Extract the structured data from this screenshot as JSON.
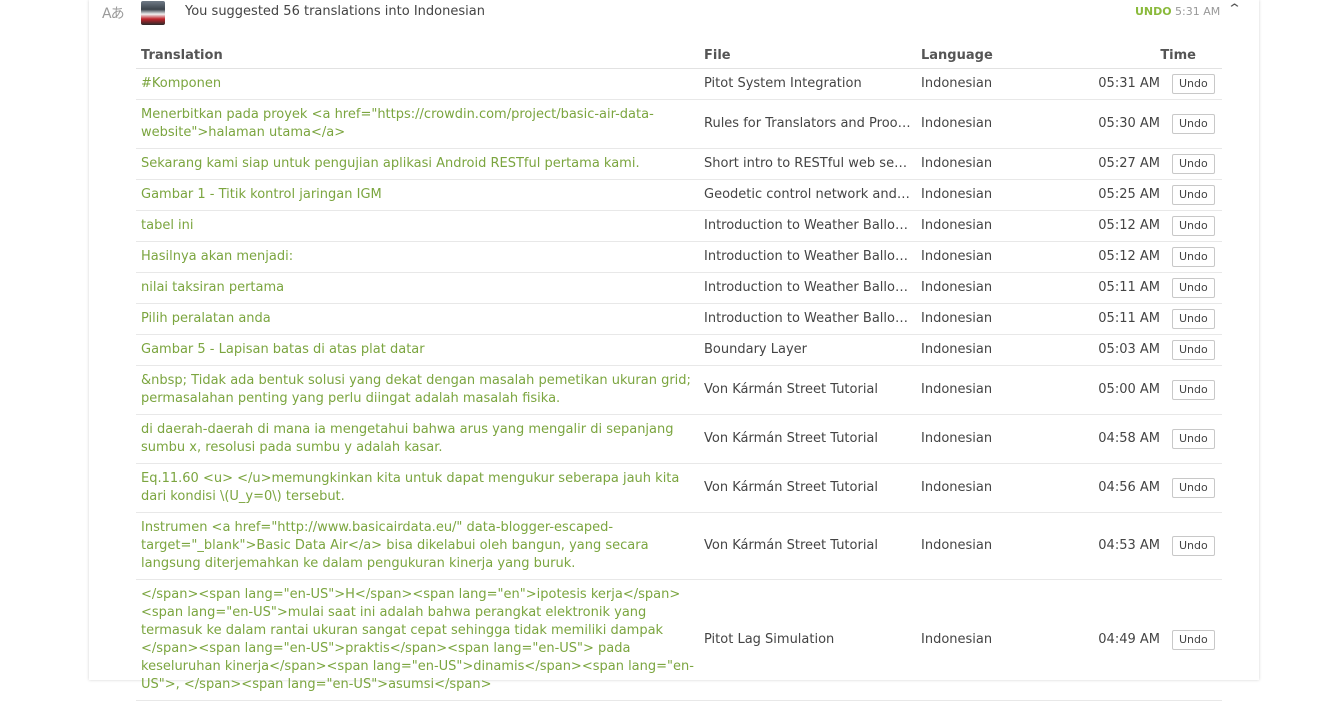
{
  "header": {
    "summary": "You suggested 56 translations into Indonesian",
    "undo_label": "UNDO",
    "time": "5:31 AM",
    "translate_icon": "translate-icon",
    "chevron_icon": "chevron-up-icon"
  },
  "table": {
    "headers": {
      "translation": "Translation",
      "file": "File",
      "language": "Language",
      "time": "Time"
    },
    "undo_button": "Undo",
    "rows": [
      {
        "translation": "#Komponen",
        "file": "Pitot System Integration",
        "language": "Indonesian",
        "time": "05:31 AM"
      },
      {
        "translation": "Menerbitkan pada proyek <a href=\"https://crowdin.com/project/basic-air-data-website\">halaman utama</a>",
        "file": "Rules for Translators and Proofreaders",
        "language": "Indonesian",
        "time": "05:30 AM"
      },
      {
        "translation": "Sekarang kami siap untuk pengujian aplikasi Android RESTful pertama kami.",
        "file": "Short intro to RESTful web services",
        "language": "Indonesian",
        "time": "05:27 AM"
      },
      {
        "translation": "Gambar 1 - Titik kontrol jaringan IGM",
        "file": "Geodetic control network and datum",
        "language": "Indonesian",
        "time": "05:25 AM"
      },
      {
        "translation": "tabel ini",
        "file": "Introduction to Weather Balloons",
        "language": "Indonesian",
        "time": "05:12 AM"
      },
      {
        "translation": "Hasilnya akan menjadi:",
        "file": "Introduction to Weather Balloons",
        "language": "Indonesian",
        "time": "05:12 AM"
      },
      {
        "translation": "nilai taksiran pertama",
        "file": "Introduction to Weather Balloons",
        "language": "Indonesian",
        "time": "05:11 AM"
      },
      {
        "translation": "Pilih peralatan anda",
        "file": "Introduction to Weather Balloons",
        "language": "Indonesian",
        "time": "05:11 AM"
      },
      {
        "translation": "Gambar 5 - Lapisan batas di atas plat datar",
        "file": "Boundary Layer",
        "language": "Indonesian",
        "time": "05:03 AM"
      },
      {
        "translation": "&nbsp; Tidak ada bentuk solusi yang dekat dengan masalah pemetikan ukuran grid; permasalahan penting yang perlu diingat adalah masalah fisika.",
        "file": "Von Kármán Street Tutorial",
        "language": "Indonesian",
        "time": "05:00 AM"
      },
      {
        "translation": "di daerah-daerah di mana ia mengetahui bahwa arus yang mengalir di sepanjang sumbu x, resolusi pada sumbu y adalah kasar.",
        "file": "Von Kármán Street Tutorial",
        "language": "Indonesian",
        "time": "04:58 AM"
      },
      {
        "translation": "Eq.11.60 <u> </u>memungkinkan kita untuk dapat mengukur seberapa jauh kita dari kondisi \\(U_y=0\\) tersebut.",
        "file": "Von Kármán Street Tutorial",
        "language": "Indonesian",
        "time": "04:56 AM"
      },
      {
        "translation": "Instrumen <a href=\"http://www.basicairdata.eu/\" data-blogger-escaped-target=\"_blank\">Basic Data Air</a> bisa dikelabui oleh bangun, yang secara langsung diterjemahkan ke dalam pengukuran kinerja yang buruk.",
        "file": "Von Kármán Street Tutorial",
        "language": "Indonesian",
        "time": "04:53 AM"
      },
      {
        "translation": "</span><span lang=\"en-US\">H</span><span lang=\"en\">ipotesis kerja</span> <span lang=\"en-US\">mulai saat ini adalah bahwa perangkat elektronik yang termasuk ke dalam rantai ukuran sangat cepat sehingga tidak memiliki dampak </span><span lang=\"en-US\">praktis</span><span lang=\"en-US\"> pada keseluruhan kinerja</span><span lang=\"en-US\">dinamis</span><span lang=\"en-US\">, </span><span lang=\"en-US\">asumsi</span>",
        "file": "Pitot Lag Simulation",
        "language": "Indonesian",
        "time": "04:49 AM"
      }
    ]
  }
}
